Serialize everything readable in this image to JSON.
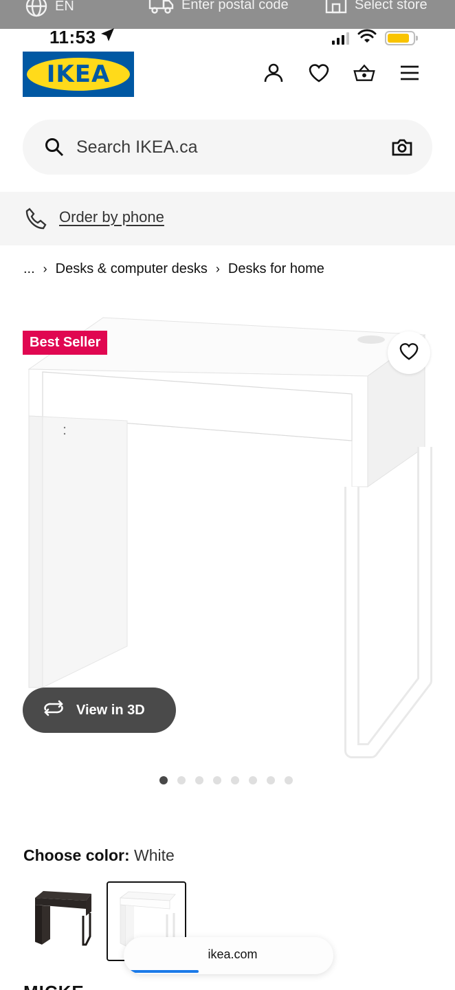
{
  "util_bar": {
    "language": "EN",
    "postal": "Enter postal code",
    "store": "Select store"
  },
  "status_bar": {
    "time": "11:53",
    "battery_level": 0.85,
    "battery_color": "#f9c400"
  },
  "header": {
    "logo_text": "IKEA",
    "icons": [
      "user-icon",
      "heart-icon",
      "basket-icon",
      "menu-icon"
    ]
  },
  "search": {
    "placeholder": "Search IKEA.ca"
  },
  "phone": {
    "label": "Order by phone"
  },
  "breadcrumb": {
    "ellipsis": "...",
    "items": [
      "Desks & computer desks",
      "Desks for home"
    ]
  },
  "product": {
    "badge": "Best Seller",
    "badge_color": "#e00751",
    "view3d_label": "View in 3D",
    "image_count": 8,
    "active_image": 1,
    "name": "MICKE"
  },
  "color": {
    "label": "Choose color:",
    "value": "White",
    "options": [
      "black-brown",
      "white"
    ],
    "selected": "white"
  },
  "browser": {
    "url": "ikea.com",
    "load_progress": 0.35,
    "progress_color": "#1b7ae8"
  }
}
